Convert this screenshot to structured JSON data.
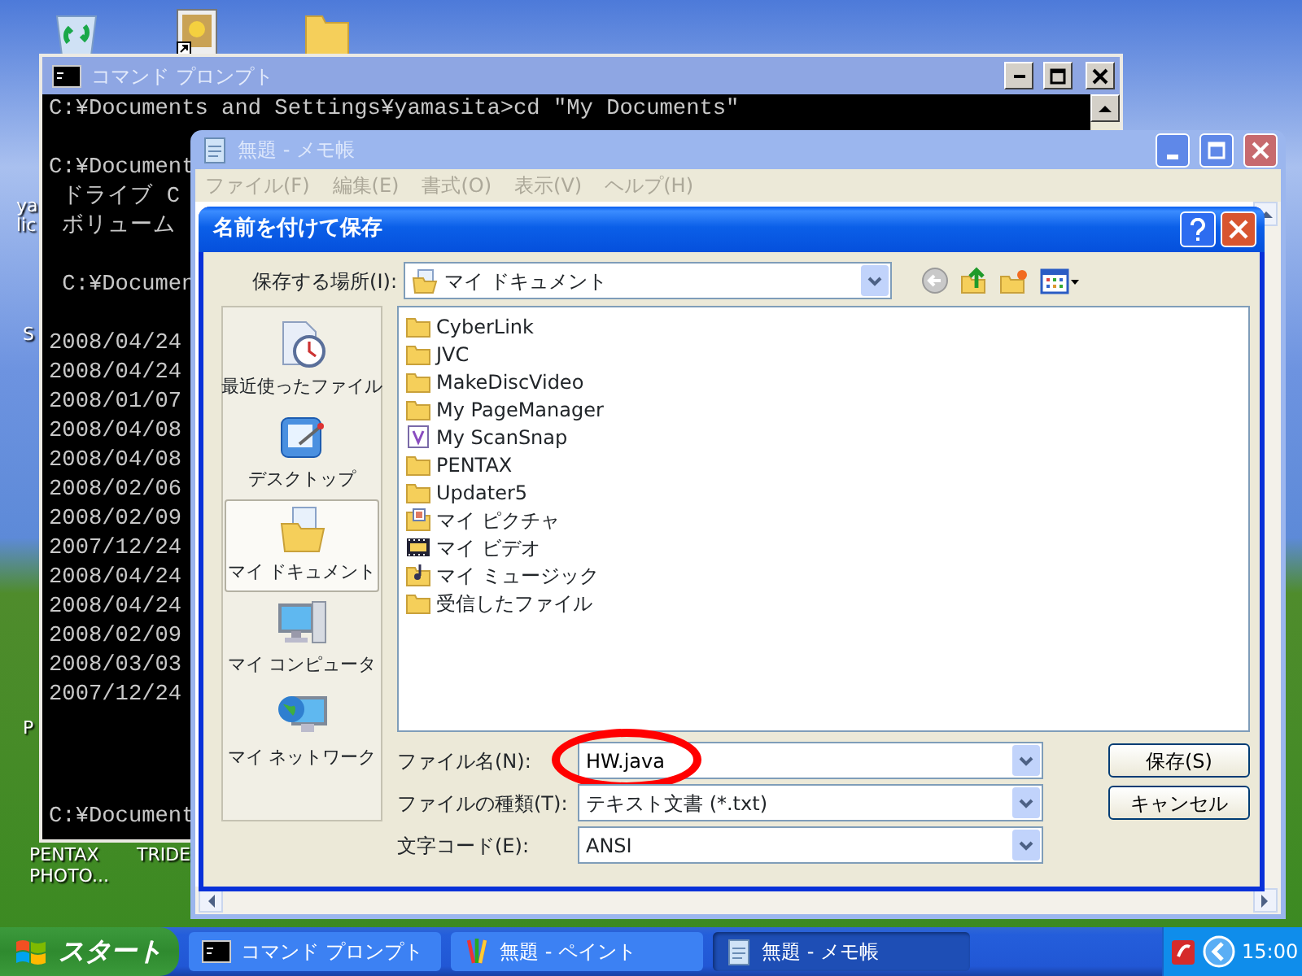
{
  "desktop": {
    "icons": [
      {
        "kind": "recycle"
      },
      {
        "kind": "picture"
      },
      {
        "kind": "folder"
      }
    ],
    "labels": [
      {
        "text": "ya"
      },
      {
        "text": "lic"
      },
      {
        "text": "S"
      },
      {
        "text": "P"
      },
      {
        "text": "PENTAX PHOTO..."
      },
      {
        "text": "TRIDE"
      }
    ]
  },
  "cmd_window": {
    "title": "コマンド プロンプト",
    "blocks": [
      [
        "C:¥Documents and Settings¥yamasita>cd \"My Documents\""
      ],
      [
        "C:¥Document",
        " ドライブ C",
        " ボリューム"
      ],
      [
        " C:¥Documen"
      ],
      [
        "2008/04/24",
        "2008/04/24",
        "2008/01/07",
        "2008/04/08",
        "2008/04/08",
        "2008/02/06",
        "2008/02/09",
        "2007/12/24",
        "2008/04/24",
        "2008/04/24",
        "2008/02/09",
        "2008/03/03",
        "2007/12/24"
      ],
      [
        "C:¥Document"
      ]
    ]
  },
  "notepad": {
    "title": "無題 - メモ帳",
    "menu": [
      "ファイル(F)",
      "編集(E)",
      "書式(O)",
      "表示(V)",
      "ヘルプ(H)"
    ]
  },
  "save_dialog": {
    "title": "名前を付けて保存",
    "location": {
      "label": "保存する場所(I):",
      "value": "マイ ドキュメント"
    },
    "places": [
      {
        "label": "最近使ったファイル",
        "kind": "recent",
        "selected": false
      },
      {
        "label": "デスクトップ",
        "kind": "desktop",
        "selected": false
      },
      {
        "label": "マイ ドキュメント",
        "kind": "documents",
        "selected": true
      },
      {
        "label": "マイ コンピュータ",
        "kind": "computer",
        "selected": false
      },
      {
        "label": "マイ ネットワーク",
        "kind": "network",
        "selected": false
      }
    ],
    "files": [
      {
        "name": "CyberLink",
        "kind": "folder"
      },
      {
        "name": "JVC",
        "kind": "folder"
      },
      {
        "name": "MakeDiscVideo",
        "kind": "folder"
      },
      {
        "name": "My PageManager",
        "kind": "folder"
      },
      {
        "name": "My ScanSnap",
        "kind": "app"
      },
      {
        "name": "PENTAX",
        "kind": "folder"
      },
      {
        "name": "Updater5",
        "kind": "folder"
      },
      {
        "name": "マイ ピクチャ",
        "kind": "pictures"
      },
      {
        "name": "マイ ビデオ",
        "kind": "video"
      },
      {
        "name": "マイ ミュージック",
        "kind": "music"
      },
      {
        "name": "受信したファイル",
        "kind": "folder"
      }
    ],
    "fields": [
      {
        "label": "ファイル名(N):",
        "value": "HW.java",
        "kind": "editable",
        "circled": true
      },
      {
        "label": "ファイルの種類(T):",
        "value": "テキスト文書 (*.txt)",
        "kind": "select",
        "circled": false
      },
      {
        "label": "文字コード(E):",
        "value": "ANSI",
        "kind": "select",
        "circled": false
      }
    ],
    "buttons": [
      "保存(S)",
      "キャンセル"
    ]
  },
  "taskbar": {
    "start": "スタート",
    "tasks": [
      {
        "label": "コマンド プロンプト",
        "kind": "console",
        "selected": false
      },
      {
        "label": "無題 - ペイント",
        "kind": "paint",
        "selected": false
      },
      {
        "label": "無題 - メモ帳",
        "kind": "notepad",
        "selected": true
      }
    ],
    "clock": "15:00"
  }
}
